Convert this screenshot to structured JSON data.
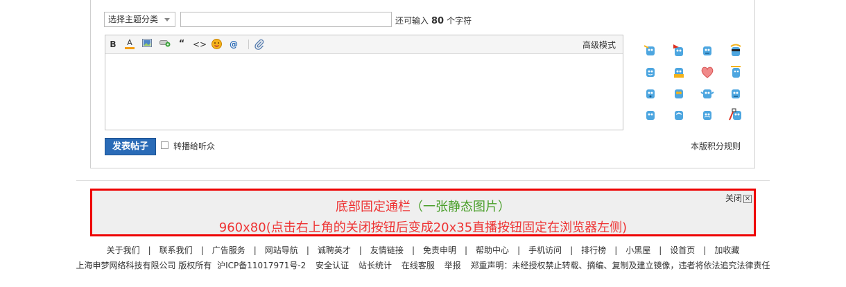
{
  "post_form": {
    "category_select": "选择主题分类",
    "remaining_prefix": "还可输入",
    "remaining_count": "80",
    "remaining_suffix": "个字符",
    "toolbar": {
      "bold": "B",
      "font_color": "A",
      "quote": "“",
      "code": "<>",
      "at": "@",
      "advanced_mode": "高级模式"
    },
    "submit_label": "发表帖子",
    "broadcast_label": "转播给听众",
    "rules_link": "本版积分规则"
  },
  "smilies": [
    "smiley-1",
    "smiley-2",
    "smiley-3",
    "smiley-4",
    "smiley-5",
    "smiley-6",
    "smiley-heart",
    "smiley-8",
    "smiley-9",
    "smiley-10",
    "smiley-11",
    "smiley-12",
    "smiley-13",
    "smiley-14",
    "smiley-15",
    "smiley-16"
  ],
  "banner": {
    "line1_red": "底部固定通栏",
    "line1_green": "（一张静态图片）",
    "line2": "960x80(点击右上角的关闭按钮后变成20x35直播按钮固定在浏览器左侧)",
    "close_label": "关闭",
    "close_icon": "⊠"
  },
  "footer_links": [
    "关于我们",
    "联系我们",
    "广告服务",
    "网站导航",
    "诚聘英才",
    "友情链接",
    "免责申明",
    "帮助中心",
    "手机访问",
    "排行榜",
    "小黑屋",
    "设首页",
    "加收藏"
  ],
  "footer": {
    "company": "上海申梦网络科技有限公司 版权所有",
    "icp": "沪ICP备11017971号-2",
    "security": "安全认证",
    "stats": "站长统计",
    "service": "在线客服",
    "report": "举报",
    "disclaimer": "郑重声明：未经授权禁止转载、摘编、复制及建立镜像，违者将依法追究法律责任"
  },
  "colors": {
    "banner_border": "#e00000",
    "banner_text": "#e33333",
    "banner_green": "#4a9f2a",
    "submit_bg": "#2a6bb7"
  }
}
